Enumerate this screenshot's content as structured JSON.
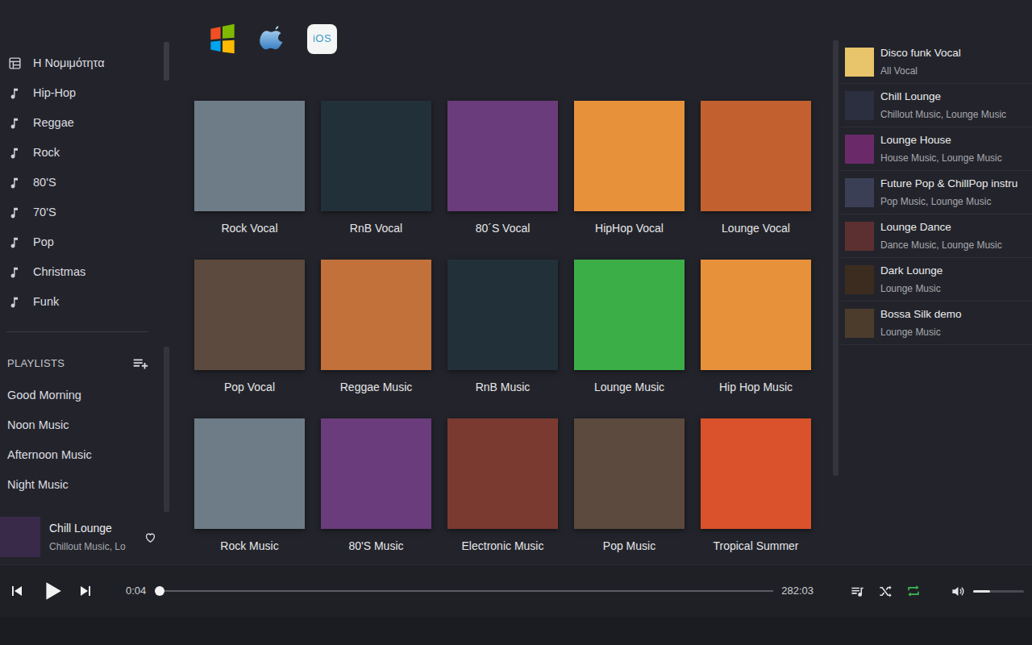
{
  "os_badges": {
    "ios_label": "iOS"
  },
  "sidebar": {
    "items": [
      {
        "label": "Η Νομιμότητα",
        "kind": "home"
      },
      {
        "label": "Hip-Hop",
        "kind": "genre"
      },
      {
        "label": "Reggae",
        "kind": "genre"
      },
      {
        "label": "Rock",
        "kind": "genre"
      },
      {
        "label": "80'S",
        "kind": "genre"
      },
      {
        "label": "70'S",
        "kind": "genre"
      },
      {
        "label": "Pop",
        "kind": "genre"
      },
      {
        "label": "Christmas",
        "kind": "genre"
      },
      {
        "label": "Funk",
        "kind": "genre"
      }
    ]
  },
  "playlists": {
    "title": "PLAYLISTS",
    "items": [
      "Good Morning",
      "Noon Music",
      "Afternoon Music",
      "Night Music"
    ]
  },
  "now_playing": {
    "title": "Chill Lounge",
    "subtitle": "Chillout Music, Lo",
    "liked": false
  },
  "grid": [
    {
      "title": "Rock Vocal"
    },
    {
      "title": "RnB Vocal"
    },
    {
      "title": "80´S Vocal"
    },
    {
      "title": "HipHop Vocal"
    },
    {
      "title": "Lounge Vocal"
    },
    {
      "title": "Pop Vocal"
    },
    {
      "title": "Reggae Music"
    },
    {
      "title": "RnB Music"
    },
    {
      "title": "Lounge Music"
    },
    {
      "title": "Hip Hop Music"
    },
    {
      "title": "Rock Music"
    },
    {
      "title": "80'S Music"
    },
    {
      "title": "Electronic Music"
    },
    {
      "title": "Pop Music"
    },
    {
      "title": "Tropical Summer"
    }
  ],
  "queue": [
    {
      "title": "Disco funk Vocal",
      "subtitle": "All Vocal"
    },
    {
      "title": "Chill Lounge",
      "subtitle": "Chillout Music, Lounge Music"
    },
    {
      "title": "Lounge House",
      "subtitle": "House Music, Lounge Music"
    },
    {
      "title": "Future Pop & ChillPop instru",
      "subtitle": "Pop Music, Lounge Music"
    },
    {
      "title": "Lounge Dance",
      "subtitle": "Dance Music, Lounge Music"
    },
    {
      "title": "Dark Lounge",
      "subtitle": "Lounge Music"
    },
    {
      "title": "Bossa Silk demo",
      "subtitle": "Lounge Music"
    }
  ],
  "player": {
    "elapsed": "0:04",
    "total": "282:03",
    "level": 0,
    "playing": false,
    "shuffle": false,
    "repeat": true,
    "volume": 0.33
  }
}
